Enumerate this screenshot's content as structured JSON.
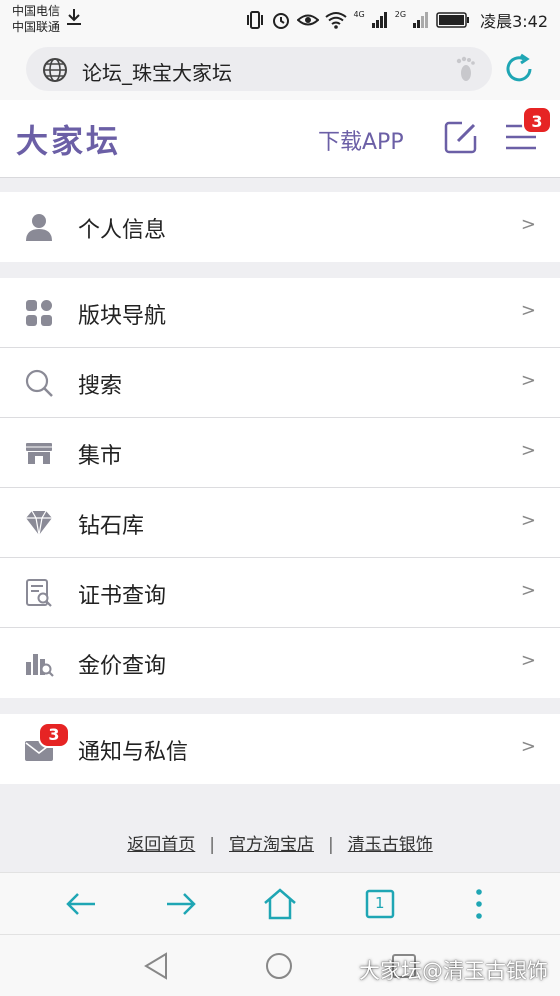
{
  "status_bar": {
    "carrier_1": "中国电信",
    "carrier_2": "中国联通",
    "net_4g": "4G",
    "net_2g": "2G",
    "time": "凌晨3:42"
  },
  "browser": {
    "url": "论坛_珠宝大家坛",
    "tab_count": "1"
  },
  "header": {
    "logo": "大家坛",
    "download_app": "下载APP",
    "menu_badge": "3"
  },
  "menu_groups": [
    [
      {
        "label": "个人信息",
        "arrow": ">"
      }
    ],
    [
      {
        "label": "版块导航",
        "arrow": ">"
      },
      {
        "label": "搜索",
        "arrow": ">"
      },
      {
        "label": "集市",
        "arrow": ">"
      },
      {
        "label": "钻石库",
        "arrow": ">"
      },
      {
        "label": "证书查询",
        "arrow": ">"
      },
      {
        "label": "金价查询",
        "arrow": ">"
      }
    ],
    [
      {
        "label": "通知与私信",
        "arrow": ">",
        "badge": "3"
      }
    ]
  ],
  "footer": {
    "links": [
      "返回首页",
      "官方淘宝店",
      "清玉古银饰"
    ],
    "separator": "|"
  },
  "watermark": "大家坛@清玉古银饰",
  "colors": {
    "brand": "#6b5fa6",
    "badge": "#e62424",
    "browser_accent": "#1fa6b4",
    "icon_gray": "#8a8a96"
  }
}
